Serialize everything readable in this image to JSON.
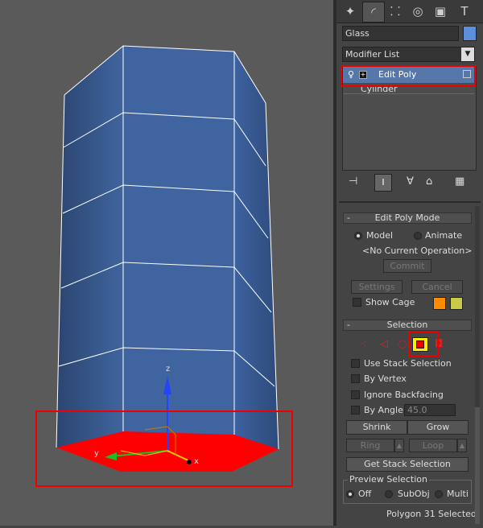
{
  "toolbar": {
    "tabs": [
      {
        "name": "create-tab",
        "glyph": "✦"
      },
      {
        "name": "modify-tab",
        "glyph": "◜"
      },
      {
        "name": "hierarchy-tab",
        "glyph": "⸬"
      },
      {
        "name": "motion-tab",
        "glyph": "◎"
      },
      {
        "name": "display-tab",
        "glyph": "▣"
      },
      {
        "name": "utilities-tab",
        "glyph": "T"
      }
    ]
  },
  "object": {
    "name": "Glass",
    "color": "#5b8fd8"
  },
  "modifier_list": {
    "label": "Modifier List"
  },
  "stack": {
    "items": [
      {
        "label": "Edit Poly",
        "selected": true
      },
      {
        "label": "Cylinder",
        "selected": false
      }
    ]
  },
  "edit_poly_mode": {
    "title": "Edit Poly Mode",
    "model_label": "Model",
    "animate_label": "Animate",
    "operation": "<No Current Operation>",
    "commit_label": "Commit",
    "settings_label": "Settings",
    "cancel_label": "Cancel",
    "show_cage_label": "Show Cage",
    "cage_color_1": "#ff8c00",
    "cage_color_2": "#c8c84a"
  },
  "selection": {
    "title": "Selection",
    "use_stack_selection": "Use Stack Selection",
    "by_vertex": "By Vertex",
    "ignore_backfacing": "Ignore Backfacing",
    "by_angle": "By Angle:",
    "angle_value": "45.0",
    "shrink_label": "Shrink",
    "grow_label": "Grow",
    "ring_label": "Ring",
    "loop_label": "Loop",
    "get_stack_selection": "Get Stack Selection",
    "preview_title": "Preview Selection",
    "preview_off": "Off",
    "preview_subobj": "SubObj",
    "preview_multi": "Multi",
    "status": "Polygon 31 Selected"
  },
  "viewport": {
    "gizmo_labels": {
      "x": "x",
      "y": "y",
      "z": "z"
    },
    "object_color": "#3b5f95",
    "selected_face_color": "#ff0000"
  }
}
